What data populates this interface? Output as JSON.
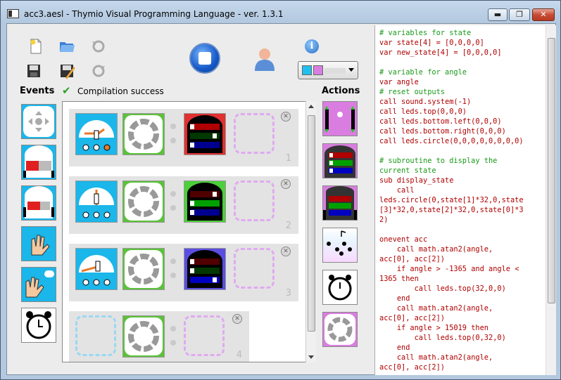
{
  "window": {
    "title": "acc3.aesl - Thymio Visual Programming Language - ver. 1.3.1",
    "min_label": "▬",
    "max_label": "❐",
    "close_label": "✕"
  },
  "toolbar": {
    "icons": [
      "new-file-icon",
      "open-folder-icon",
      "undo-icon",
      "save-icon",
      "save-as-icon",
      "redo-icon",
      "stop-icon",
      "user-icon",
      "info-icon"
    ],
    "info_label": "i"
  },
  "colors": {
    "event_blue": "#1bb6ea",
    "state_green": "#5bc23a",
    "action_pink": "#d97ee0",
    "success": "#2aa12a"
  },
  "labels": {
    "events": "Events",
    "actions": "Actions",
    "compilation": "Compilation success",
    "check": "✔"
  },
  "events_palette": [
    "buttons-event",
    "proximity-event",
    "ground-event",
    "tap-event",
    "clap-event",
    "timer-event"
  ],
  "actions_palette": [
    "motors-action",
    "top-color-action",
    "bottom-color-action",
    "music-action",
    "timer-action",
    "state-action"
  ],
  "rows": [
    {
      "number": "1",
      "remove": "✕",
      "add": "+"
    },
    {
      "number": "2",
      "remove": "✕",
      "add": "+"
    },
    {
      "number": "3",
      "remove": "✕",
      "add": "+"
    },
    {
      "number": "4",
      "remove": "✕"
    }
  ],
  "code": {
    "lines": [
      {
        "t": "# variables for state",
        "c": "cm"
      },
      {
        "t": "var state[4] = [0,0,0,0]",
        "c": "kw"
      },
      {
        "t": "var new_state[4] = [0,0,0,0]",
        "c": "kw"
      },
      {
        "t": "",
        "c": ""
      },
      {
        "t": "# variable for angle",
        "c": "cm"
      },
      {
        "t": "var angle",
        "c": "kw"
      },
      {
        "t": "# reset outputs",
        "c": "cm"
      },
      {
        "t": "call sound.system(-1)",
        "c": "kw"
      },
      {
        "t": "call leds.top(0,0,0)",
        "c": "kw"
      },
      {
        "t": "call leds.bottom.left(0,0,0)",
        "c": "kw"
      },
      {
        "t": "call leds.bottom.right(0,0,0)",
        "c": "kw"
      },
      {
        "t": "call leds.circle(0,0,0,0,0,0,0,0)",
        "c": "kw"
      },
      {
        "t": "",
        "c": ""
      },
      {
        "t": "# subroutine to display the",
        "c": "cm"
      },
      {
        "t": "current state",
        "c": "cm"
      },
      {
        "t": "sub display_state",
        "c": "kw"
      },
      {
        "t": "    call",
        "c": "kw"
      },
      {
        "t": "leds.circle(0,state[1]*32,0,state",
        "c": "kw"
      },
      {
        "t": "[3]*32,0,state[2]*32,0,state[0]*3",
        "c": "kw"
      },
      {
        "t": "2)",
        "c": "kw"
      },
      {
        "t": "",
        "c": ""
      },
      {
        "t": "onevent acc",
        "c": "kw"
      },
      {
        "t": "    call math.atan2(angle,",
        "c": "kw"
      },
      {
        "t": "acc[0], acc[2])",
        "c": "kw"
      },
      {
        "t": "    if angle > -1365 and angle <",
        "c": "kw"
      },
      {
        "t": "1365 then",
        "c": "kw"
      },
      {
        "t": "        call leds.top(32,0,0)",
        "c": "kw"
      },
      {
        "t": "    end",
        "c": "kw"
      },
      {
        "t": "    call math.atan2(angle,",
        "c": "kw"
      },
      {
        "t": "acc[0], acc[2])",
        "c": "kw"
      },
      {
        "t": "    if angle > 15019 then",
        "c": "kw"
      },
      {
        "t": "        call leds.top(0,32,0)",
        "c": "kw"
      },
      {
        "t": "    end",
        "c": "kw"
      },
      {
        "t": "    call math.atan2(angle,",
        "c": "kw"
      },
      {
        "t": "acc[0], acc[2])",
        "c": "kw"
      }
    ]
  }
}
